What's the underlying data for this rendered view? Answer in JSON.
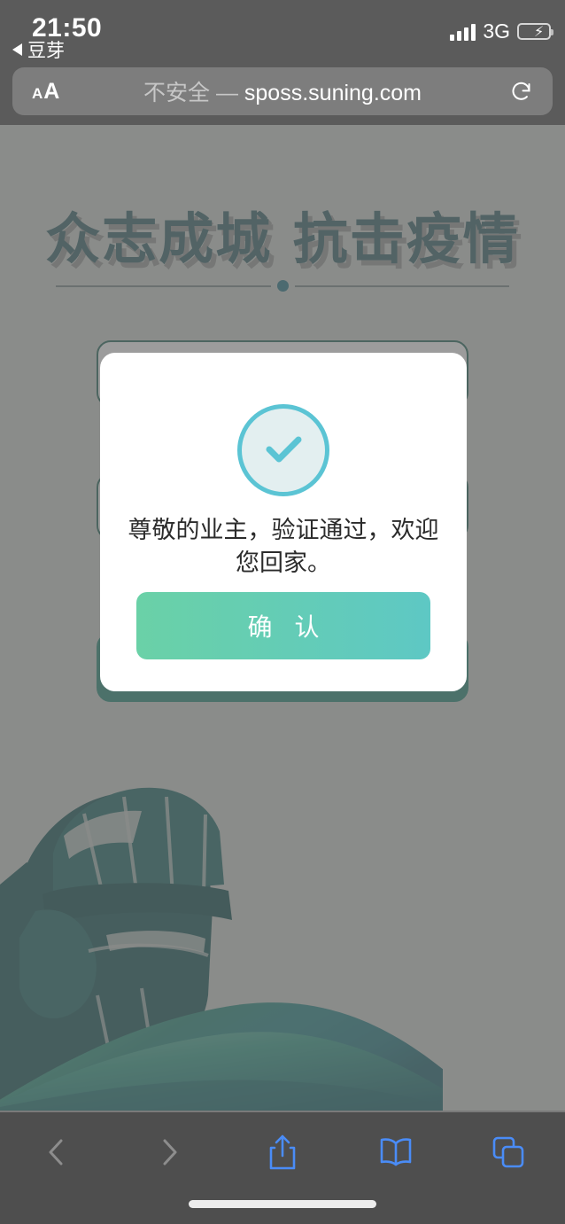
{
  "status_bar": {
    "time": "21:50",
    "back_app_label": "豆芽",
    "back_caret_icon": "back-triangle-icon",
    "signal_icon": "signal-bars-icon",
    "network": "3G",
    "battery_icon": "battery-charging-icon",
    "battery_percent_fill": 45
  },
  "address_bar": {
    "text_size_label_small": "A",
    "text_size_label_large": "A",
    "security_label": "不安全",
    "separator": " — ",
    "domain": "sposs.suning.com",
    "reload_icon": "reload-icon"
  },
  "page": {
    "headline": "众志成城 抗击疫情",
    "divider_icon": "divider-dot-icon",
    "background_card": {
      "field_1": "",
      "field_2": "",
      "submit": ""
    },
    "illustration_name": "raised-fist-with-ribbon-illustration"
  },
  "modal": {
    "status_icon": "check-circle-icon",
    "message": "尊敬的业主，验证通过，欢迎您回家。",
    "confirm_label": "确 认"
  },
  "toolbar": {
    "items": [
      {
        "name": "back-button",
        "icon": "chevron-left-icon",
        "enabled": false
      },
      {
        "name": "forward-button",
        "icon": "chevron-right-icon",
        "enabled": false
      },
      {
        "name": "share-button",
        "icon": "share-icon",
        "enabled": true
      },
      {
        "name": "bookmarks-button",
        "icon": "book-icon",
        "enabled": true
      },
      {
        "name": "tabs-button",
        "icon": "tabs-icon",
        "enabled": true
      }
    ],
    "home_indicator": "home-indicator"
  },
  "colors": {
    "accent_teal": "#5bc4d4",
    "button_gradient_start": "#6ad1a7",
    "button_gradient_end": "#5ec8c4",
    "headline_teal": "#3d6b70",
    "toolbar_blue": "#4a8cf7",
    "page_bg": "#cfd4cf"
  }
}
